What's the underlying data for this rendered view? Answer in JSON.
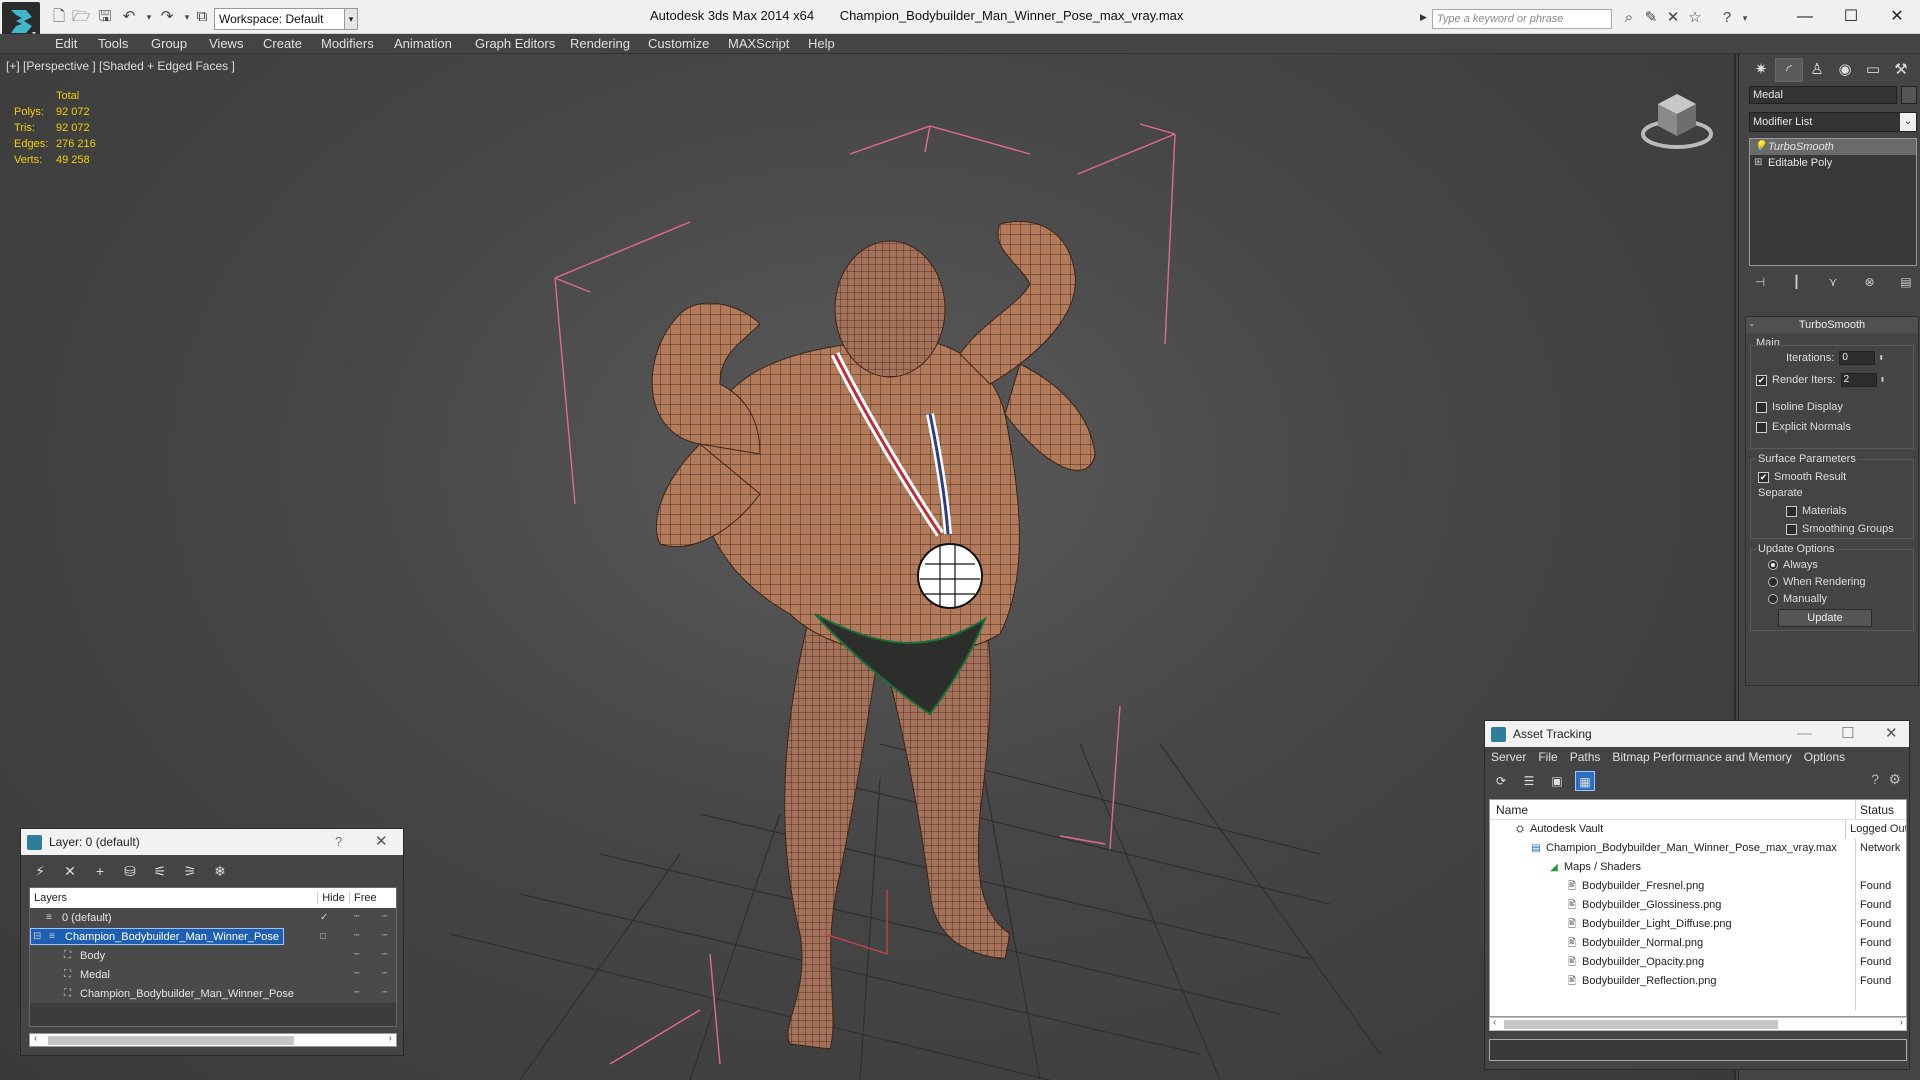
{
  "app": {
    "title": "Autodesk 3ds Max  2014 x64",
    "filename": "Champion_Bodybuilder_Man_Winner_Pose_max_vray.max",
    "workspace_label": "Workspace: Default",
    "search_placeholder": "Type a keyword or phrase"
  },
  "menu": [
    "Edit",
    "Tools",
    "Group",
    "Views",
    "Create",
    "Modifiers",
    "Animation",
    "Graph Editors",
    "Rendering",
    "Customize",
    "MAXScript",
    "Help"
  ],
  "viewport": {
    "label": "[+] [Perspective ] [Shaded + Edged Faces ]",
    "stats": {
      "header": "Total",
      "rows": [
        {
          "k": "Polys:",
          "v": "92 072"
        },
        {
          "k": "Tris:",
          "v": "92 072"
        },
        {
          "k": "Edges:",
          "v": "276 216"
        },
        {
          "k": "Verts:",
          "v": "49 258"
        }
      ]
    },
    "colors": {
      "skin": "#b07a5a",
      "wire": "#3a2418",
      "bbox": "#e06a90",
      "grid": "#2e2e2e"
    }
  },
  "command_panel": {
    "object_name": "Medal",
    "modifier_list": "Modifier List",
    "stack": [
      {
        "label": "TurboSmooth",
        "selected": true
      },
      {
        "label": "Editable Poly",
        "selected": false
      }
    ],
    "rollout_title": "TurboSmooth",
    "main_label": "Main",
    "iterations_label": "Iterations:",
    "iterations_value": "0",
    "render_iters_label": "Render Iters:",
    "render_iters_value": "2",
    "isoline_label": "Isoline Display",
    "explicit_normals_label": "Explicit Normals",
    "surface_params_label": "Surface Parameters",
    "smooth_result_label": "Smooth Result",
    "separate_label": "Separate",
    "materials_label": "Materials",
    "smoothing_groups_label": "Smoothing Groups",
    "update_options_label": "Update Options",
    "always_label": "Always",
    "when_rendering_label": "When Rendering",
    "manually_label": "Manually",
    "update_button": "Update"
  },
  "layer_dialog": {
    "title": "Layer: 0 (default)",
    "help": "?",
    "col_layers": "Layers",
    "col_hide": "Hide",
    "col_freeze": "Free",
    "rows": [
      {
        "name": "0 (default)",
        "indent": 1,
        "selected": false,
        "marker": "✓"
      },
      {
        "name": "Champion_Bodybuilder_Man_Winner_Pose",
        "indent": 1,
        "selected": true,
        "marker": "□"
      },
      {
        "name": "Body",
        "indent": 2,
        "selected": false,
        "marker": ""
      },
      {
        "name": "Medal",
        "indent": 2,
        "selected": false,
        "marker": ""
      },
      {
        "name": "Champion_Bodybuilder_Man_Winner_Pose",
        "indent": 2,
        "selected": false,
        "marker": ""
      }
    ]
  },
  "asset_tracking": {
    "title": "Asset Tracking",
    "menu": [
      "Server",
      "File",
      "Paths",
      "Bitmap Performance and Memory",
      "Options"
    ],
    "col_name": "Name",
    "col_status": "Status",
    "rows": [
      {
        "name": "Autodesk Vault",
        "status": "Logged Out",
        "indent": 1,
        "icon": "vault-icon"
      },
      {
        "name": "Champion_Bodybuilder_Man_Winner_Pose_max_vray.max",
        "status": "Network",
        "indent": 2,
        "icon": "scene-file-icon"
      },
      {
        "name": "Maps / Shaders",
        "status": "",
        "indent": 3,
        "icon": "maps-folder-icon"
      },
      {
        "name": "Bodybuilder_Fresnel.png",
        "status": "Found",
        "indent": 4,
        "icon": "bitmap-file-icon"
      },
      {
        "name": "Bodybuilder_Glossiness.png",
        "status": "Found",
        "indent": 4,
        "icon": "bitmap-file-icon"
      },
      {
        "name": "Bodybuilder_Light_Diffuse.png",
        "status": "Found",
        "indent": 4,
        "icon": "bitmap-file-icon"
      },
      {
        "name": "Bodybuilder_Normal.png",
        "status": "Found",
        "indent": 4,
        "icon": "bitmap-file-icon"
      },
      {
        "name": "Bodybuilder_Opacity.png",
        "status": "Found",
        "indent": 4,
        "icon": "bitmap-file-icon"
      },
      {
        "name": "Bodybuilder_Reflection.png",
        "status": "Found",
        "indent": 4,
        "icon": "bitmap-file-icon"
      }
    ]
  }
}
